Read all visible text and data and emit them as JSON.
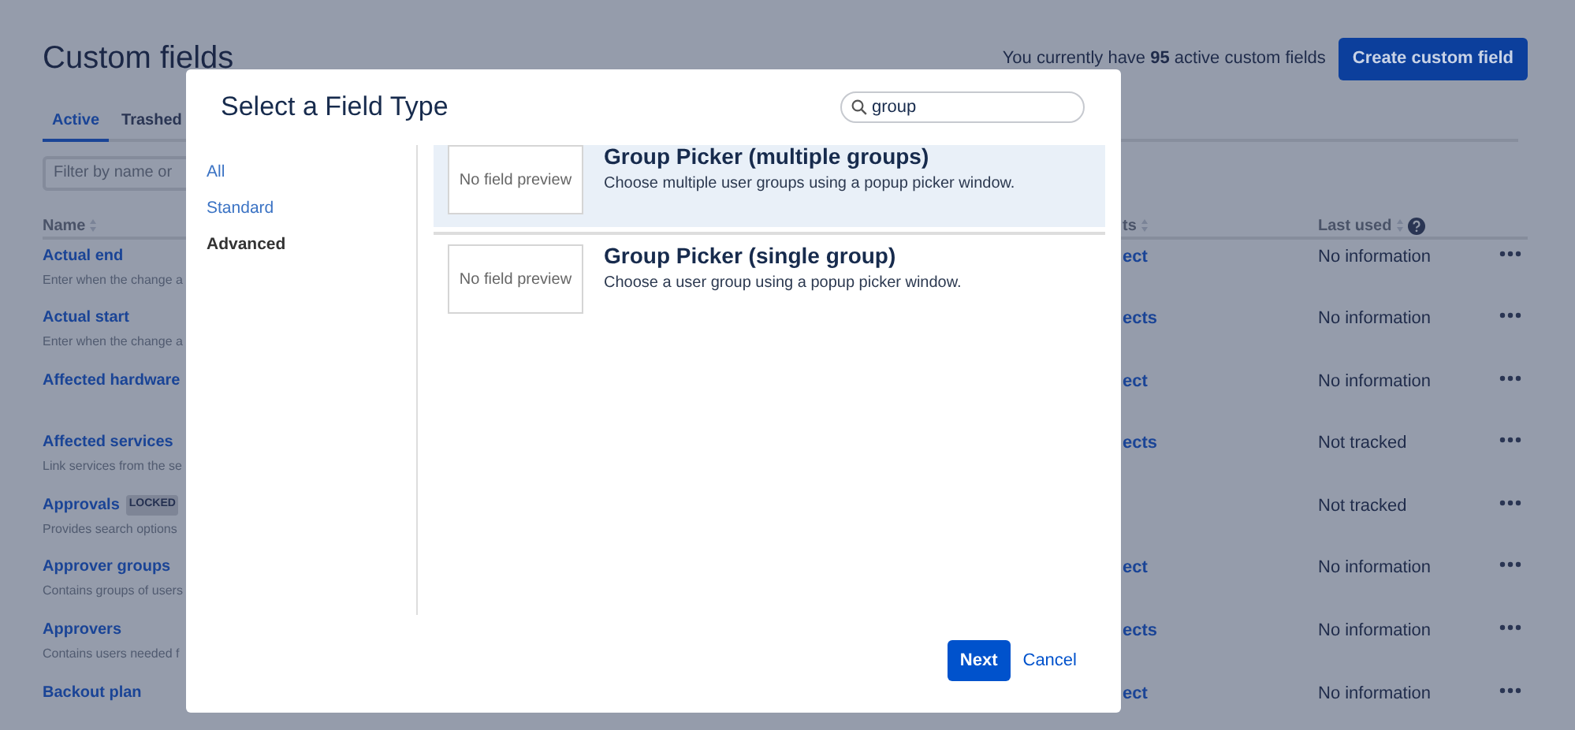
{
  "page": {
    "title": "Custom fields",
    "summary": "You currently have **95** active custom fields",
    "create_button": "Create custom field",
    "tabs": [
      {
        "label": "Active",
        "selected": true
      },
      {
        "label": "Trashed",
        "selected": false
      }
    ],
    "filter": {
      "placeholder": "Filter by name or"
    },
    "columns": [
      {
        "label": "Name",
        "help": false
      },
      {
        "label": "ts",
        "help": false
      },
      {
        "label": "Last used",
        "help": true
      }
    ],
    "rows": [
      {
        "name": "Actual end",
        "description": "Enter when the change a",
        "projects": "ect",
        "last_used": "No information"
      },
      {
        "name": "Actual start",
        "description": "Enter when the change a",
        "projects": "ects",
        "last_used": "No information"
      },
      {
        "name": "Affected hardware",
        "projects": "ect",
        "last_used": "No information"
      },
      {
        "name": "Affected services",
        "description": "Link services from the se",
        "projects": "ects",
        "last_used": "Not tracked"
      },
      {
        "name": "Approvals",
        "badge": "LOCKED",
        "description": "Provides search options",
        "last_used": "Not tracked"
      },
      {
        "name": "Approver groups",
        "description": "Contains groups of users",
        "projects": "ect",
        "last_used": "No information"
      },
      {
        "name": "Approvers",
        "description": "Contains users needed f",
        "projects": "ects",
        "last_used": "No information"
      },
      {
        "name": "Backout plan",
        "projects": "ect",
        "last_used": "No information"
      }
    ]
  },
  "dialog": {
    "title": "Select a Field Type",
    "search": {
      "value": "group"
    },
    "categories": [
      {
        "label": "All",
        "selected": false
      },
      {
        "label": "Standard",
        "selected": false
      },
      {
        "label": "Advanced",
        "selected": true
      }
    ],
    "results": [
      {
        "preview": "No field preview",
        "title": "Group Picker (multiple groups)",
        "description": "Choose multiple user groups using a popup picker window.",
        "selected": true
      },
      {
        "preview": "No field preview",
        "title": "Group Picker (single group)",
        "description": "Choose a user group using a popup picker window.",
        "selected": false
      }
    ],
    "buttons": [
      {
        "label": "Next",
        "kind": "primary"
      },
      {
        "label": "Cancel",
        "kind": "link"
      }
    ]
  }
}
